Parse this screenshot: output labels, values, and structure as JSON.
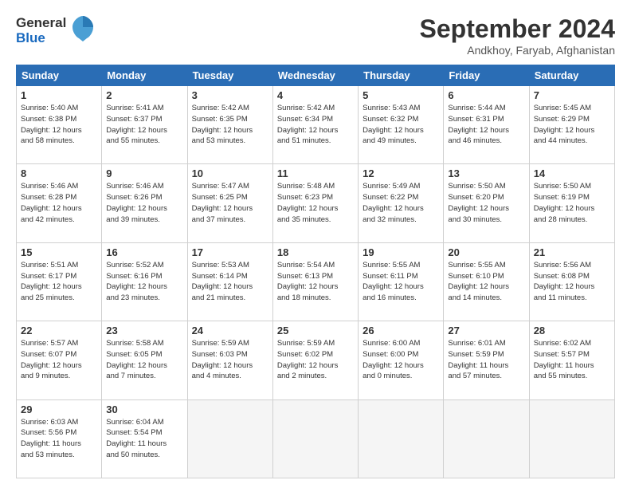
{
  "header": {
    "logo_line1": "General",
    "logo_line2": "Blue",
    "main_title": "September 2024",
    "subtitle": "Andkhoy, Faryab, Afghanistan"
  },
  "calendar": {
    "days_of_week": [
      "Sunday",
      "Monday",
      "Tuesday",
      "Wednesday",
      "Thursday",
      "Friday",
      "Saturday"
    ],
    "weeks": [
      [
        null,
        {
          "day": "2",
          "sunrise": "5:41 AM",
          "sunset": "6:37 PM",
          "daylight_hours": "12",
          "daylight_minutes": "55"
        },
        {
          "day": "3",
          "sunrise": "5:42 AM",
          "sunset": "6:35 PM",
          "daylight_hours": "12",
          "daylight_minutes": "53"
        },
        {
          "day": "4",
          "sunrise": "5:42 AM",
          "sunset": "6:34 PM",
          "daylight_hours": "12",
          "daylight_minutes": "51"
        },
        {
          "day": "5",
          "sunrise": "5:43 AM",
          "sunset": "6:32 PM",
          "daylight_hours": "12",
          "daylight_minutes": "49"
        },
        {
          "day": "6",
          "sunrise": "5:44 AM",
          "sunset": "6:31 PM",
          "daylight_hours": "12",
          "daylight_minutes": "46"
        },
        {
          "day": "7",
          "sunrise": "5:45 AM",
          "sunset": "6:29 PM",
          "daylight_hours": "12",
          "daylight_minutes": "44"
        }
      ],
      [
        {
          "day": "1",
          "sunrise": "5:40 AM",
          "sunset": "6:38 PM",
          "daylight_hours": "12",
          "daylight_minutes": "58"
        },
        {
          "day": "9",
          "sunrise": "5:46 AM",
          "sunset": "6:26 PM",
          "daylight_hours": "12",
          "daylight_minutes": "39"
        },
        {
          "day": "10",
          "sunrise": "5:47 AM",
          "sunset": "6:25 PM",
          "daylight_hours": "12",
          "daylight_minutes": "37"
        },
        {
          "day": "11",
          "sunrise": "5:48 AM",
          "sunset": "6:23 PM",
          "daylight_hours": "12",
          "daylight_minutes": "35"
        },
        {
          "day": "12",
          "sunrise": "5:49 AM",
          "sunset": "6:22 PM",
          "daylight_hours": "12",
          "daylight_minutes": "32"
        },
        {
          "day": "13",
          "sunrise": "5:50 AM",
          "sunset": "6:20 PM",
          "daylight_hours": "12",
          "daylight_minutes": "30"
        },
        {
          "day": "14",
          "sunrise": "5:50 AM",
          "sunset": "6:19 PM",
          "daylight_hours": "12",
          "daylight_minutes": "28"
        }
      ],
      [
        {
          "day": "8",
          "sunrise": "5:46 AM",
          "sunset": "6:28 PM",
          "daylight_hours": "12",
          "daylight_minutes": "42"
        },
        {
          "day": "16",
          "sunrise": "5:52 AM",
          "sunset": "6:16 PM",
          "daylight_hours": "12",
          "daylight_minutes": "23"
        },
        {
          "day": "17",
          "sunrise": "5:53 AM",
          "sunset": "6:14 PM",
          "daylight_hours": "12",
          "daylight_minutes": "21"
        },
        {
          "day": "18",
          "sunrise": "5:54 AM",
          "sunset": "6:13 PM",
          "daylight_hours": "12",
          "daylight_minutes": "18"
        },
        {
          "day": "19",
          "sunrise": "5:55 AM",
          "sunset": "6:11 PM",
          "daylight_hours": "12",
          "daylight_minutes": "16"
        },
        {
          "day": "20",
          "sunrise": "5:55 AM",
          "sunset": "6:10 PM",
          "daylight_hours": "12",
          "daylight_minutes": "14"
        },
        {
          "day": "21",
          "sunrise": "5:56 AM",
          "sunset": "6:08 PM",
          "daylight_hours": "12",
          "daylight_minutes": "11"
        }
      ],
      [
        {
          "day": "15",
          "sunrise": "5:51 AM",
          "sunset": "6:17 PM",
          "daylight_hours": "12",
          "daylight_minutes": "25"
        },
        {
          "day": "23",
          "sunrise": "5:58 AM",
          "sunset": "6:05 PM",
          "daylight_hours": "12",
          "daylight_minutes": "7"
        },
        {
          "day": "24",
          "sunrise": "5:59 AM",
          "sunset": "6:03 PM",
          "daylight_hours": "12",
          "daylight_minutes": "4"
        },
        {
          "day": "25",
          "sunrise": "5:59 AM",
          "sunset": "6:02 PM",
          "daylight_hours": "12",
          "daylight_minutes": "2"
        },
        {
          "day": "26",
          "sunrise": "6:00 AM",
          "sunset": "6:00 PM",
          "daylight_hours": "12",
          "daylight_minutes": "0"
        },
        {
          "day": "27",
          "sunrise": "6:01 AM",
          "sunset": "5:59 PM",
          "daylight_hours": "11",
          "daylight_minutes": "57"
        },
        {
          "day": "28",
          "sunrise": "6:02 AM",
          "sunset": "5:57 PM",
          "daylight_hours": "11",
          "daylight_minutes": "55"
        }
      ],
      [
        {
          "day": "22",
          "sunrise": "5:57 AM",
          "sunset": "6:07 PM",
          "daylight_hours": "12",
          "daylight_minutes": "9"
        },
        {
          "day": "30",
          "sunrise": "6:04 AM",
          "sunset": "5:54 PM",
          "daylight_hours": "11",
          "daylight_minutes": "50"
        },
        null,
        null,
        null,
        null,
        null
      ],
      [
        {
          "day": "29",
          "sunrise": "6:03 AM",
          "sunset": "5:56 PM",
          "daylight_hours": "11",
          "daylight_minutes": "53"
        },
        null,
        null,
        null,
        null,
        null,
        null
      ]
    ]
  }
}
